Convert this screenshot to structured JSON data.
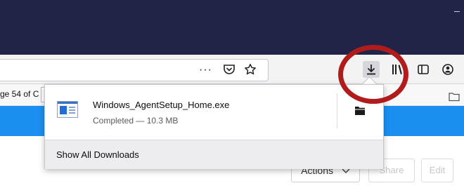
{
  "navbar": {
    "overflow_label": "···"
  },
  "toolbar": {
    "icons": [
      "page-actions-icon",
      "pocket-icon",
      "bookmark-star-icon",
      "downloads-icon",
      "library-icon",
      "sidebar-icon",
      "account-icon"
    ]
  },
  "page": {
    "page_of_text": "ge 54 of C",
    "actions_label": "Actions",
    "share_label": "Share",
    "edit_label": "Edit"
  },
  "downloads_panel": {
    "item": {
      "filename": "Windows_AgentSetup_Home.exe",
      "status": "Completed — 10.3 MB"
    },
    "show_all_label": "Show All Downloads"
  },
  "colors": {
    "titlebar": "#212446",
    "accent_band": "#1b8fef",
    "highlight_ring": "#b01c1c"
  }
}
